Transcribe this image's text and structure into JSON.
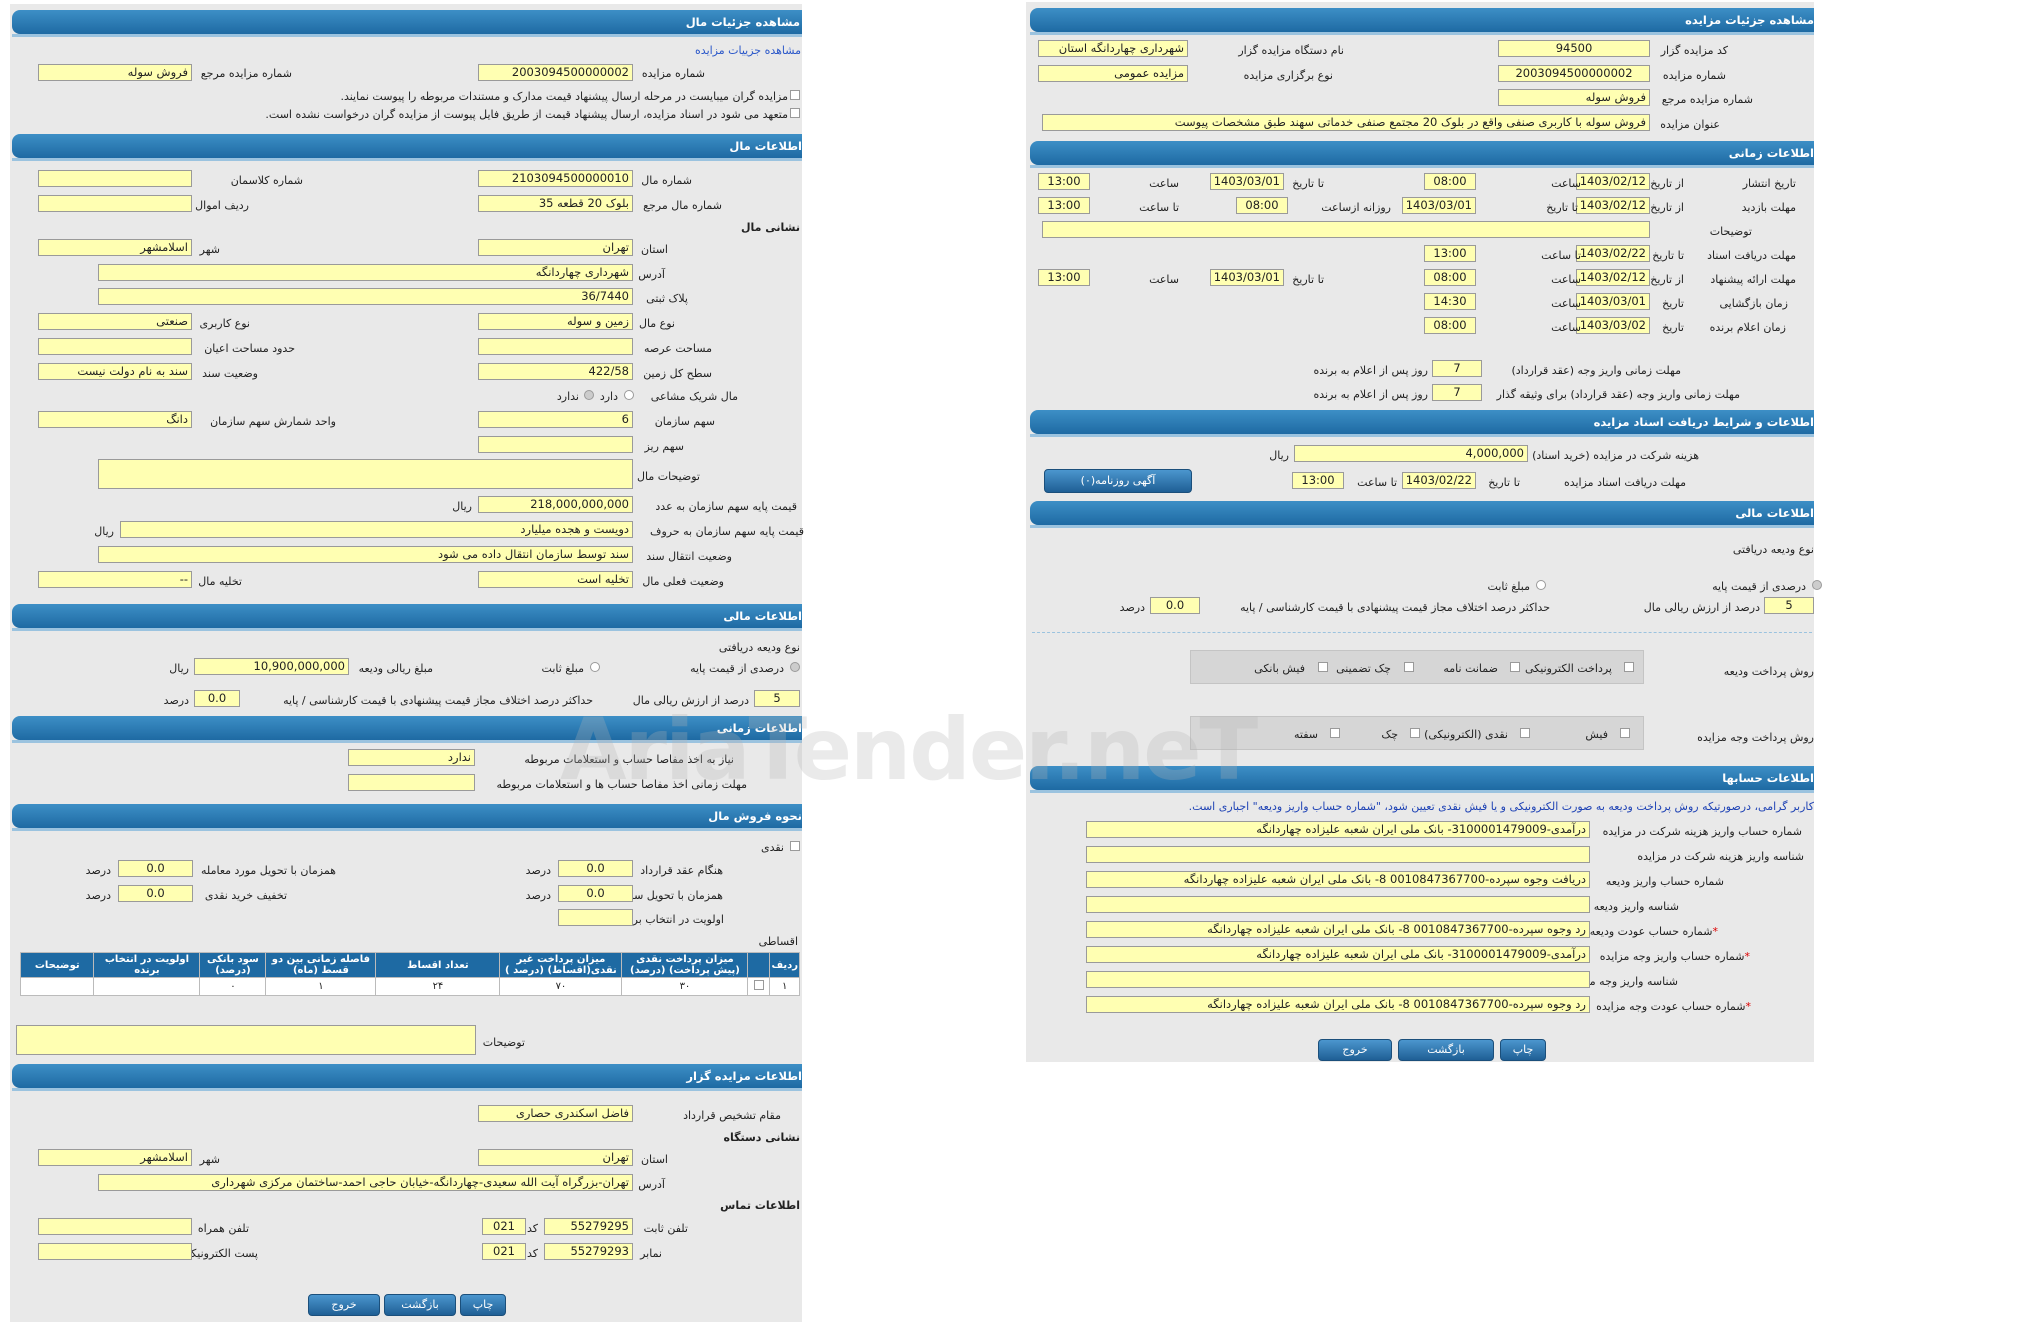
{
  "left": {
    "h_details": "مشاهده جزئیات مال",
    "link_auction_details": "مشاهده جزییات مزایده",
    "lbl_auction_no": "شماره مزایده",
    "auction_no": "2003094500000002",
    "lbl_ref_no": "شماره مزایده مرجع",
    "ref_no": "فروش سوله",
    "note1": "مزایده گران میبایست در مرحله ارسال پیشنهاد قیمت مدارک و مستندات مربوطه را پیوست نمایند.",
    "note2": "متعهد می شود در اسناد مزایده، ارسال پیشنهاد قیمت از طریق فایل پیوست از مزایده گران درخواست نشده است.",
    "h_property": "اطلاعات مال",
    "lbl_prop_no": "شماره مال",
    "prop_no": "2103094500000010",
    "lbl_class_no": "شماره کلاسمان",
    "class_no": "",
    "lbl_ref_prop": "شماره مال مرجع",
    "ref_prop": "بلوک 20 قطعه 35",
    "lbl_row_assets": "ردیف اموال",
    "row_assets": "",
    "sub_address": "نشانی مال",
    "lbl_province": "استان",
    "province": "تهران",
    "lbl_city": "شهر",
    "city": "اسلامشهر",
    "lbl_address": "آدرس",
    "address": "شهرداری چهاردانگه",
    "lbl_plaque": "پلاک ثبتی",
    "plaque": "36/7440",
    "lbl_prop_type": "نوع مال",
    "prop_type": "زمین و سوله",
    "lbl_usage": "نوع کاربری",
    "usage": "صنعتی",
    "lbl_area": "مساحت عرصه",
    "area": "",
    "lbl_building_limit": "حدود مساحت اعیان",
    "building_limit": "",
    "lbl_total_land": "سطح کل زمین",
    "total_land": "422/58",
    "lbl_doc_status": "وضعیت سند",
    "doc_status": "سند به نام دولت نیست",
    "lbl_shared": "مال شریک مشاعی",
    "opt_has": "دارد",
    "opt_hasnot": "ندارد",
    "lbl_org_share": "سهم سازمان",
    "org_share": "6",
    "lbl_share_unit": "واحد شمارش سهم سازمان",
    "share_unit": "دانگ",
    "lbl_minor_share": "سهم ریز",
    "minor_share": "",
    "lbl_desc": "توضیحات مال",
    "desc": "",
    "lbl_base_price": "قیمت پایه سهم سازمان به عدد",
    "base_price": "218,000,000,000",
    "rial": "ریال",
    "lbl_base_words": "قیمت پایه سهم سازمان به حروف",
    "base_words": "دویست و هجده میلیارد",
    "lbl_transfer": "وضعیت انتقال سند",
    "transfer": "سند توسط سازمان انتقال داده می شود",
    "lbl_current": "وضعیت فعلی مال",
    "current": "تخلیه است",
    "lbl_evacuate": "تخلیه مال",
    "evacuate": "--",
    "h_finance": "اطلاعات مالی",
    "lbl_deposit_type": "نوع ودیعه دریافتی",
    "opt_percent_base": "درصدی از قیمت پایه",
    "opt_fixed": "مبلغ ثابت",
    "lbl_deposit_amount": "مبلغ ریالی ودیعه",
    "deposit_amount": "10,900,000,000",
    "pct_val": "5",
    "lbl_pct": "درصد از ارزش ریالی مال",
    "lbl_max_diff": "حداکثر درصد اختلاف مجاز قیمت پیشنهادی با قیمت کارشناسی / پایه",
    "max_diff": "0.0",
    "lbl_percent": "درصد",
    "h_time": "اطلاعات زمانی",
    "lbl_need_settle": "نیاز به اخذ مفاصا حساب و استعلامات مربوطه",
    "need_settle": "ندارد",
    "lbl_settle_deadline": "مهلت زمانی اخذ مفاصا حساب ها و استعلامات مربوطه",
    "settle_deadline": "",
    "h_sale": "نحوه فروش مال",
    "lbl_cash": "نقدی",
    "lbl_contract": "هنگام عقد قرارداد",
    "contract": "0.0",
    "lbl_with_deal": "همزمان با تحویل مورد معامله",
    "with_deal": "0.0",
    "lbl_with_doc": "همزمان با تحویل سند",
    "with_doc": "0.0",
    "lbl_cash_discount": "تخفیف خرید نقدی",
    "cash_discount": "0.0",
    "lbl_priority": "اولویت در انتخاب برنده",
    "priority": "",
    "lbl_install": "اقساطی",
    "table_headers": [
      "ردیف",
      "",
      "میزان پرداخت نقدی (پیش پرداخت) (درصد)",
      "میزان پرداخت غیر نقدی(اقساط) (درصد )",
      "تعداد اقساط",
      "فاصله زمانی بین دو قسط (ماه)",
      "سود بانکی (درصد)",
      "اولویت در انتخاب برنده",
      "توضیحات"
    ],
    "table_row": [
      "۱",
      "",
      "۳۰",
      "۷۰",
      "۲۴",
      "۱",
      "۰",
      "",
      ""
    ],
    "lbl_notes": "توضیحات",
    "notes": "",
    "h_auctioneer": "اطلاعات مزایده گزار",
    "lbl_contract_auth": "مقام تشخیص قرارداد",
    "contract_auth": "فاضل اسکندری حصاری",
    "sub_org_address": "نشانی دستگاه",
    "org_province": "تهران",
    "org_city": "اسلامشهر",
    "org_address": "تهران-بزرگراه آیت الله سعیدی-چهاردانگه-خیابان حاجی احمد-ساختمان مرکزی شهرداری",
    "sub_contact": "اطلاعات تماس",
    "lbl_phone": "تلفن ثابت",
    "phone": "55279295",
    "lbl_code": "کد",
    "phone_code": "021",
    "lbl_mobile": "تلفن همراه",
    "mobile": "",
    "lbl_fax": "نمابر",
    "fax": "55279293",
    "fax_code": "021",
    "lbl_email": "پست الکترونیکی",
    "email": "",
    "btn_print": "چاپ",
    "btn_back": "بازگشت",
    "btn_exit": "خروج"
  },
  "right": {
    "h_details": "مشاهده جزئیات مزایده",
    "lbl_code": "کد مزایده گزار",
    "code": "94500",
    "lbl_org_name": "نام دستگاه مزایده گزار",
    "org_name": "شهرداری چهاردانگه استان",
    "lbl_auction_no": "شماره مزایده",
    "auction_no": "2003094500000002",
    "lbl_holding": "نوع برگزاری مزایده",
    "holding": "مزایده عمومی",
    "lbl_ref_no": "شماره مزایده مرجع",
    "ref_no": "فروش سوله",
    "lbl_title": "عنوان مزایده",
    "title": "فروش سوله با کاربری صنفی واقع در بلوک 20 مجتمع صنفی خدماتی سهند طبق مشخصات پیوست",
    "h_time": "اطلاعات زمانی",
    "lbl_publish": "تاریخ انتشار",
    "lbl_from_date": "از تاریخ",
    "lbl_to_date": "تا تاریخ",
    "lbl_hour": "ساعت",
    "lbl_to_hour": "تا ساعت",
    "publish_date": "1403/02/12",
    "publish_time": "08:00",
    "publish_to_date": "1403/03/01",
    "publish_to_time": "13:00",
    "lbl_visit": "مهلت بازدید",
    "visit_from": "1403/02/12",
    "visit_to": "1403/03/01",
    "lbl_daily": "روزانه ازساعت",
    "visit_daily_from": "08:00",
    "visit_daily_to": "13:00",
    "lbl_desc": "توضیحات",
    "desc": "",
    "lbl_doc_deadline": "مهلت دریافت اسناد",
    "doc_deadline_date": "1403/02/22",
    "doc_deadline_time": "13:00",
    "lbl_offer": "مهلت ارائه پیشنهاد",
    "offer_from": "1403/02/12",
    "offer_from_time": "08:00",
    "offer_to": "1403/03/01",
    "offer_to_time": "13:00",
    "lbl_opening": "زمان بازگشایی",
    "lbl_date": "تاریخ",
    "opening_date": "1403/03/01",
    "opening_time": "14:30",
    "lbl_winner": "زمان اعلام برنده",
    "winner_date": "1403/03/02",
    "winner_time": "08:00",
    "lbl_pay_deadline": "مهلت زمانی واریز وجه (عقد قرارداد)",
    "pay_deadline": "7",
    "lbl_days_after": "روز پس از اعلام به برنده",
    "lbl_pay_deadline2": "مهلت زمانی واریز وجه (عقد قرارداد) برای وثیقه گذار",
    "pay_deadline2": "7",
    "h_docs": "اطلاعات و شرایط دریافت اسناد مزایده",
    "lbl_fee": "هزینه شرکت در مزایده (خرید اسناد)",
    "fee": "4,000,000",
    "rial": "ریال",
    "lbl_doc_recv": "مهلت دریافت اسناد مزایده",
    "doc_recv_date": "1403/02/22",
    "doc_recv_time": "13:00",
    "btn_news": "آگهی روزنامه(۰)",
    "h_finance": "اطلاعات مالی",
    "lbl_deposit_type": "نوع ودیعه دریافتی",
    "opt_percent_base": "درصدی از قیمت پایه",
    "opt_fixed": "مبلغ ثابت",
    "pct_val": "5",
    "lbl_pct": "درصد از ارزش ریالی مال",
    "lbl_max_diff": "حداکثر درصد اختلاف مجاز قیمت پیشنهادی با قیمت کارشناسی / پایه",
    "max_diff": "0.0",
    "lbl_percent": "درصد",
    "lbl_deposit_method": "روش پرداخت ودیعه",
    "dep_opts": [
      "پرداخت الکترونیکی",
      "ضمانت نامه",
      "چک تضمینی",
      "فیش بانکی"
    ],
    "lbl_payment_method": "روش پرداخت وجه مزایده",
    "pay_opts": [
      "فیش",
      "نقدی (الکترونیکی)",
      "چک",
      "سفته"
    ],
    "h_accounts": "اطلاعات حسابها",
    "accounts_note": "کاربر گرامی، درصورتیکه روش پرداخت ودیعه به صورت الکترونیکی و یا فیش نقدی تعیین شود، \"شماره حساب واریز ودیعه\" اجباری است.",
    "lbl_acc1": "شماره حساب واریز هزینه شرکت در مزایده",
    "acc1": "درآمدی-3100001479009- بانک ملی ایران شعبه علیزاده چهاردانگه",
    "lbl_acc2": "شناسه واریز هزینه شرکت در مزایده",
    "acc2": "",
    "lbl_acc3": "شماره حساب واریز ودیعه",
    "acc3": "دریافت وجوه سپرده-0010847367700 8- بانک ملی ایران شعبه علیزاده چهاردانگه",
    "lbl_acc4": "شناسه واریز ودیعه",
    "acc4": "",
    "lbl_acc5": "شماره حساب عودت ودیعه",
    "acc5": "رد وجوه سپرده-0010847367700 8- بانک ملی ایران شعبه علیزاده چهاردانگه",
    "lbl_acc6": "شماره حساب واریز وجه مزایده",
    "acc6": "درآمدی-3100001479009- بانک ملی ایران شعبه علیزاده چهاردانگه",
    "lbl_acc7": "شناسه واریز وجه مزایده",
    "acc7": "",
    "lbl_acc8": "شماره حساب عودت وجه مزایده",
    "acc8": "رد وجوه سپرده-0010847367700 8- بانک ملی ایران شعبه علیزاده چهاردانگه",
    "star": "*",
    "btn_print": "چاپ",
    "btn_back": "بازگشت",
    "btn_exit": "خروج"
  },
  "watermark": "AriaTender.neT"
}
